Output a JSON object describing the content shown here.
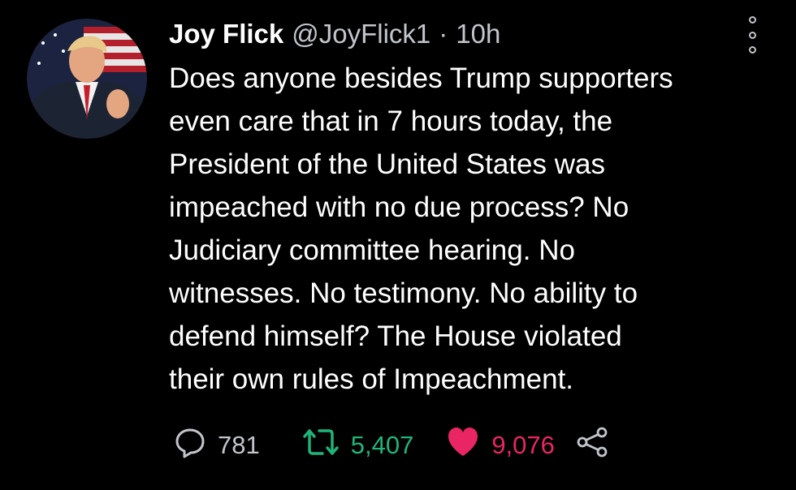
{
  "tweet": {
    "display_name": "Joy Flick",
    "handle": "@JoyFlick1",
    "separator": "·",
    "time": "10h",
    "text": "Does anyone besides Trump supporters\neven care that in 7 hours today, the\nPresident of the United States was\nimpeached with no due process? No\nJudiciary committee hearing. No\nwitnesses. No testimony. No ability to\ndefend himself? The House violated\ntheir own rules of Impeachment.",
    "avatar_icon": "profile-photo",
    "more_icon": "more-options-icon"
  },
  "actions": {
    "reply": {
      "icon": "reply-icon",
      "count": "781",
      "color": "#c2c6cb"
    },
    "retweet": {
      "icon": "retweet-icon",
      "count": "5,407",
      "color": "#1fb57a"
    },
    "like": {
      "icon": "heart-icon",
      "count": "9,076",
      "color": "#ea2563"
    },
    "share": {
      "icon": "share-icon"
    }
  },
  "colors": {
    "background": "#000000",
    "text": "#ffffff",
    "secondary_text": "#c2c6cb"
  }
}
